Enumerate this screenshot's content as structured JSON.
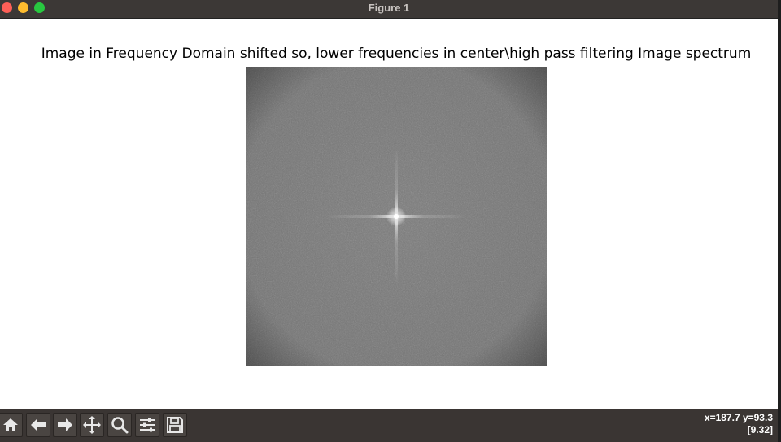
{
  "window": {
    "title": "Figure 1",
    "controls": [
      "close",
      "minimize",
      "maximize"
    ]
  },
  "figure": {
    "title": "Image in Frequency Domain shifted so, lower frequencies in center\\high pass filtering Image spectrum",
    "image": {
      "description_type": "grayscale",
      "colors": {
        "background_gray": "#7a7a7a",
        "center_bright": "#f0f0f0"
      }
    }
  },
  "toolbar": {
    "buttons": [
      {
        "name": "home-icon",
        "tooltip": "Home"
      },
      {
        "name": "back-arrow-icon",
        "tooltip": "Back"
      },
      {
        "name": "forward-arrow-icon",
        "tooltip": "Forward"
      },
      {
        "name": "pan-icon",
        "tooltip": "Pan"
      },
      {
        "name": "zoom-icon",
        "tooltip": "Zoom"
      },
      {
        "name": "configure-subplots-icon",
        "tooltip": "Subplots"
      },
      {
        "name": "save-icon",
        "tooltip": "Save"
      }
    ],
    "coords_line1": "x=187.7 y=93.3",
    "coords_line2": "[9.32]"
  }
}
